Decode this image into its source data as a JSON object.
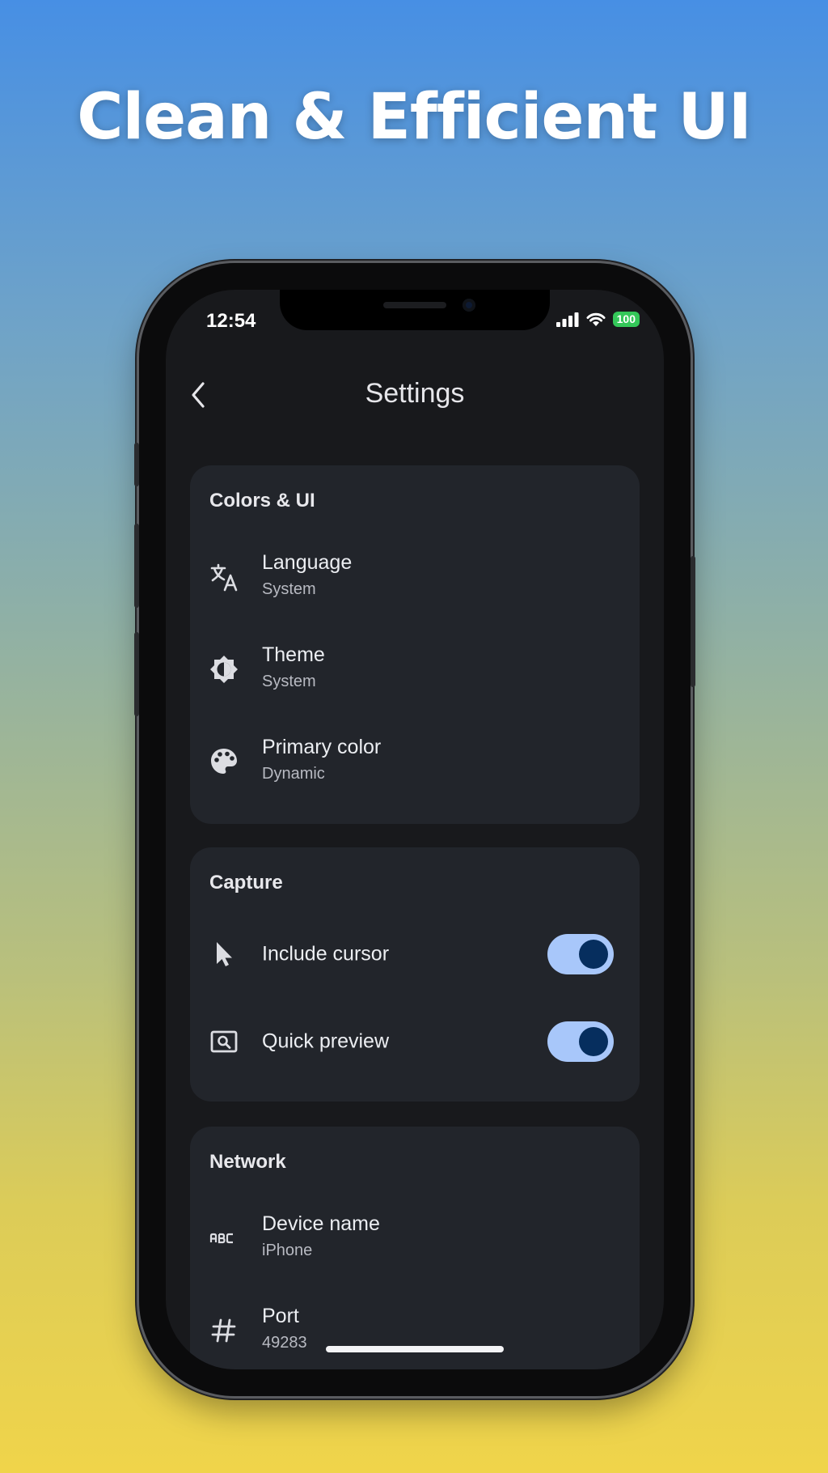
{
  "promo": {
    "headline": "Clean & Efficient UI"
  },
  "status_bar": {
    "time": "12:54",
    "battery": "100"
  },
  "header": {
    "title": "Settings"
  },
  "sections": {
    "colors_ui": {
      "title": "Colors & UI",
      "language": {
        "label": "Language",
        "value": "System",
        "icon": "translate-icon"
      },
      "theme": {
        "label": "Theme",
        "value": "System",
        "icon": "brightness-icon"
      },
      "primary_color": {
        "label": "Primary color",
        "value": "Dynamic",
        "icon": "palette-icon"
      }
    },
    "capture": {
      "title": "Capture",
      "include_cursor": {
        "label": "Include cursor",
        "enabled": true,
        "icon": "cursor-icon"
      },
      "quick_preview": {
        "label": "Quick preview",
        "enabled": true,
        "icon": "preview-icon"
      }
    },
    "network": {
      "title": "Network",
      "device_name": {
        "label": "Device name",
        "value": "iPhone",
        "icon": "abc-icon"
      },
      "port": {
        "label": "Port",
        "value": "49283",
        "icon": "hash-icon"
      }
    }
  },
  "colors": {
    "toggle_track": "#a8c7fa",
    "toggle_knob": "#062e5e",
    "card_bg": "#22252b",
    "screen_bg": "#18191c",
    "battery": "#34c759"
  }
}
